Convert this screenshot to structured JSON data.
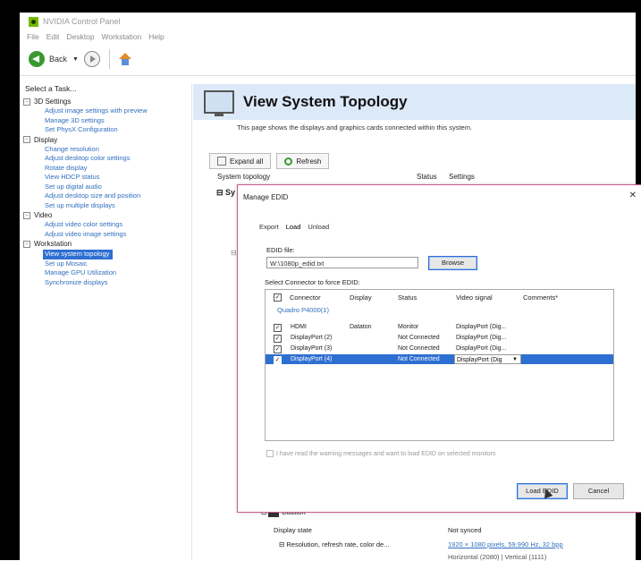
{
  "window": {
    "title": "NVIDIA Control Panel"
  },
  "menu": [
    "File",
    "Edit",
    "Desktop",
    "Workstation",
    "Help"
  ],
  "toolbar": {
    "back_label": "Back"
  },
  "tasks": {
    "header": "Select a Task...",
    "categories": [
      {
        "label": "3D Settings",
        "items": [
          "Adjust image settings with preview",
          "Manage 3D settings",
          "Set PhysX Configuration"
        ]
      },
      {
        "label": "Display",
        "items": [
          "Change resolution",
          "Adjust desktop color settings",
          "Rotate display",
          "View HDCP status",
          "Set up digital audio",
          "Adjust desktop size and position",
          "Set up multiple displays"
        ]
      },
      {
        "label": "Video",
        "items": [
          "Adjust video color settings",
          "Adjust video image settings"
        ]
      },
      {
        "label": "Workstation",
        "items": [
          "View system topology",
          "Set up Mosaic",
          "Manage GPU Utilization",
          "Synchronize displays"
        ]
      }
    ]
  },
  "page": {
    "title": "View System Topology",
    "description": "This page shows the displays and graphics cards connected within this system.",
    "expand_all_label": "Expand all",
    "refresh_label": "Refresh",
    "columns": {
      "topology": "System topology",
      "status": "Status",
      "settings": "Settings"
    },
    "row_partial": "Sy"
  },
  "dialog": {
    "title": "Manage EDID",
    "close": "✕",
    "tabs": [
      "Export",
      "Load",
      "Unload"
    ],
    "edid_file_label": "EDID file:",
    "edid_file_value": "W:\\1080p_edid.txt",
    "browse_label": "Browse",
    "select_label": "Select Connector to force EDID:",
    "grid_headers": {
      "connector": "Connector",
      "display": "Display",
      "status": "Status",
      "video_signal": "Video signal",
      "comments": "Comments*"
    },
    "gpu_group": "Quadro P4000(1)",
    "rows": [
      {
        "connector": "HDMI",
        "display": "Dataton",
        "status": "Monitor",
        "video_signal": "DisplayPort (Dig..."
      },
      {
        "connector": "DisplayPort (2)",
        "display": "",
        "status": "Not Connected",
        "video_signal": "DisplayPort (Dig..."
      },
      {
        "connector": "DisplayPort (3)",
        "display": "",
        "status": "Not Connected",
        "video_signal": "DisplayPort (Dig..."
      },
      {
        "connector": "DisplayPort (4)",
        "display": "",
        "status": "Not Connected",
        "video_signal": "DisplayPort (Dig"
      }
    ],
    "warning": "I have read the warning messages and want to load EDID on selected monitors",
    "load_label": "Load EDID",
    "cancel_label": "Cancel"
  },
  "bottom": {
    "device": "Dataton",
    "display_state_label": "Display state",
    "display_state_value": "Not synced",
    "resolution_label": "Resolution, refresh rate, color de...",
    "resolution_value": "1920 × 1080 pixels, 59.990 Hz, 32 bpp",
    "extra": "Horizontal (2080) | Vertical (1111)"
  },
  "colors": {
    "selection": "#2e6fd2",
    "banner": "#dce9f8",
    "link": "#2f6fbe",
    "dialog_border": "#c45d8f"
  }
}
